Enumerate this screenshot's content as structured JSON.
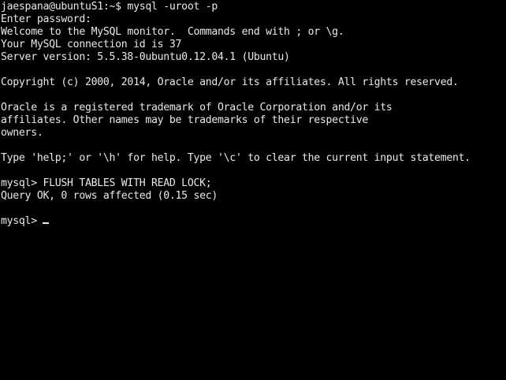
{
  "terminal": {
    "lines": [
      "jaespana@ubuntuS1:~$ mysql -uroot -p",
      "Enter password:",
      "Welcome to the MySQL monitor.  Commands end with ; or \\g.",
      "Your MySQL connection id is 37",
      "Server version: 5.5.38-0ubuntu0.12.04.1 (Ubuntu)",
      "",
      "Copyright (c) 2000, 2014, Oracle and/or its affiliates. All rights reserved.",
      "",
      "Oracle is a registered trademark of Oracle Corporation and/or its",
      "affiliates. Other names may be trademarks of their respective",
      "owners.",
      "",
      "Type 'help;' or '\\h' for help. Type '\\c' to clear the current input statement.",
      "",
      "mysql> FLUSH TABLES WITH READ LOCK;",
      "Query OK, 0 rows affected (0.15 sec)",
      "",
      "mysql> "
    ],
    "colors": {
      "background": "#000000",
      "foreground": "#e8e8e8"
    }
  }
}
